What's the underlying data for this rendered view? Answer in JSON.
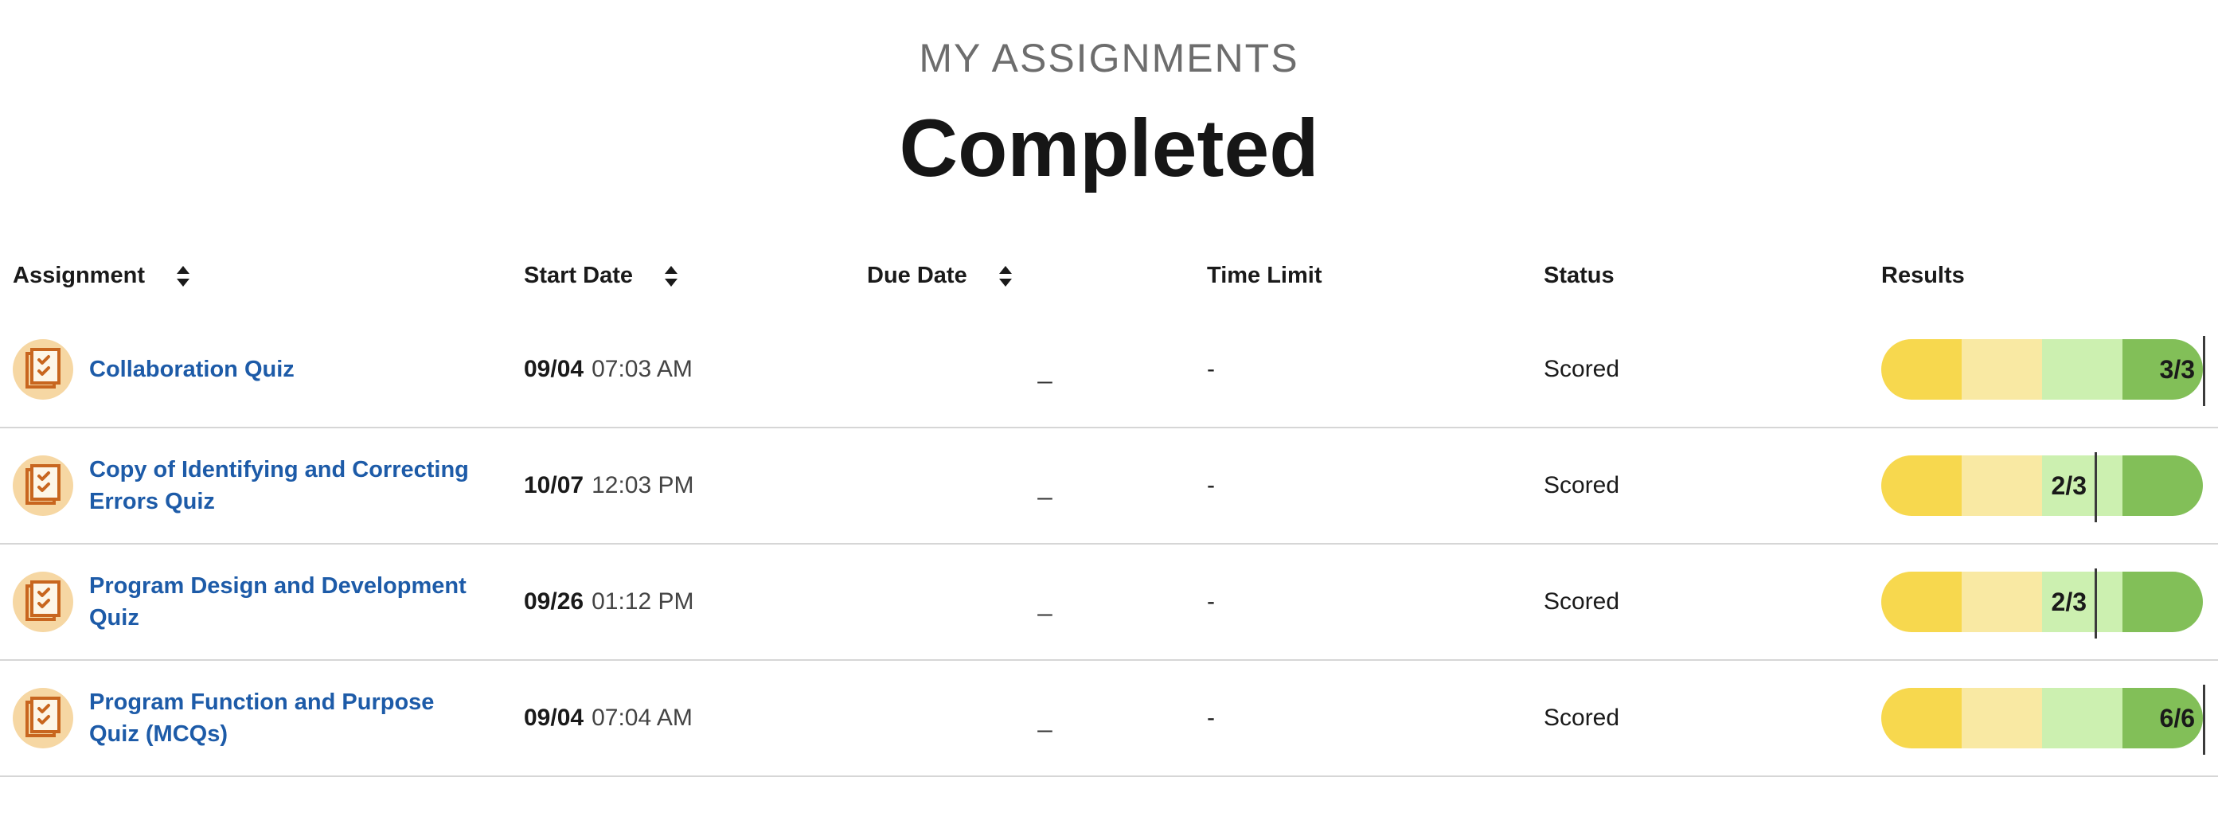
{
  "header": {
    "eyebrow": "MY ASSIGNMENTS",
    "title": "Completed"
  },
  "columns": {
    "assignment": "Assignment",
    "start_date": "Start Date",
    "due_date": "Due Date",
    "time_limit": "Time Limit",
    "status": "Status",
    "results": "Results"
  },
  "icons": {
    "sort": "sort-updown-icon",
    "quiz": "quiz-checklist-icon"
  },
  "colors": {
    "link": "#1d5ba8",
    "bar_segments": [
      "#f7d84e",
      "#f9e9a3",
      "#ccf0b0",
      "#82bf58"
    ],
    "icon_bg": "#f6d7a3",
    "icon_accent": "#c8661f"
  },
  "rows": [
    {
      "title": "Collaboration Quiz",
      "start_day": "09/04",
      "start_time": "07:03 AM",
      "due": "_",
      "time_limit": "-",
      "status": "Scored",
      "score_label": "3/3",
      "score_fraction": 1.0
    },
    {
      "title": "Copy of Identifying and Correcting Errors Quiz",
      "start_day": "10/07",
      "start_time": "12:03 PM",
      "due": "_",
      "time_limit": "-",
      "status": "Scored",
      "score_label": "2/3",
      "score_fraction": 0.6667
    },
    {
      "title": "Program Design and Development Quiz",
      "start_day": "09/26",
      "start_time": "01:12 PM",
      "due": "_",
      "time_limit": "-",
      "status": "Scored",
      "score_label": "2/3",
      "score_fraction": 0.6667
    },
    {
      "title": "Program Function and Purpose Quiz (MCQs)",
      "start_day": "09/04",
      "start_time": "07:04 AM",
      "due": "_",
      "time_limit": "-",
      "status": "Scored",
      "score_label": "6/6",
      "score_fraction": 1.0
    }
  ]
}
